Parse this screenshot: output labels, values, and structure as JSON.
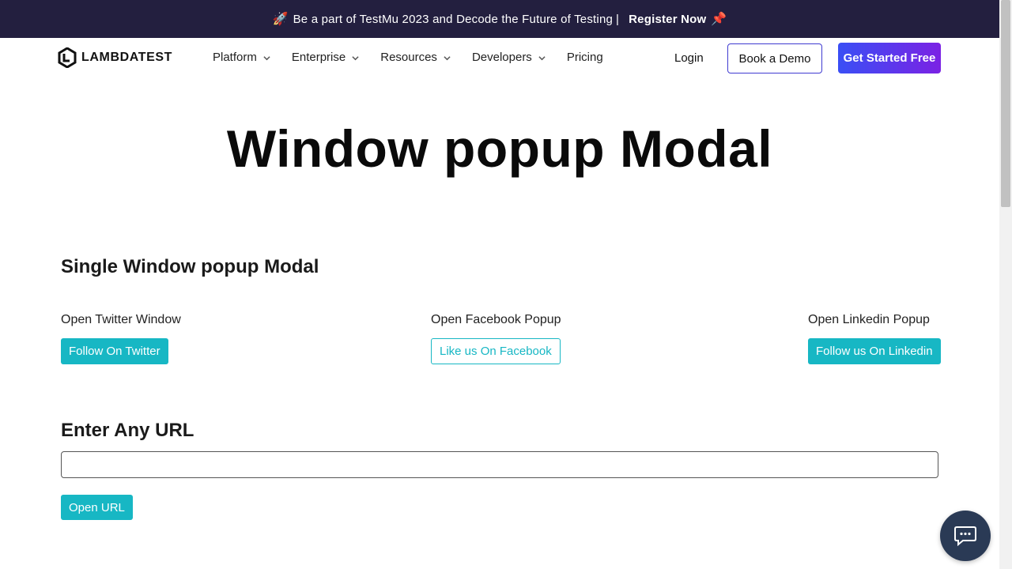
{
  "announcement": {
    "text": "Be a part of TestMu 2023 and Decode the Future of Testing",
    "separator": "|",
    "link": "Register Now",
    "rocket_icon": "rocket-icon",
    "pin_icon": "pushpin-icon"
  },
  "nav": {
    "brand": "LAMBDATEST",
    "items": [
      {
        "label": "Platform",
        "has_dropdown": true
      },
      {
        "label": "Enterprise",
        "has_dropdown": true
      },
      {
        "label": "Resources",
        "has_dropdown": true
      },
      {
        "label": "Developers",
        "has_dropdown": true
      },
      {
        "label": "Pricing",
        "has_dropdown": false
      }
    ],
    "login": "Login",
    "book_demo": "Book a Demo",
    "get_started": "Get Started Free"
  },
  "page": {
    "title": "Window popup Modal",
    "section_title": "Single Window popup Modal",
    "popups": [
      {
        "label": "Open Twitter Window",
        "button": "Follow On Twitter"
      },
      {
        "label": "Open Facebook Popup",
        "button": "Like us On Facebook"
      },
      {
        "label": "Open Linkedin Popup",
        "button": "Follow us On Linkedin"
      }
    ],
    "url_title": "Enter Any URL",
    "url_value": "",
    "url_placeholder": "",
    "open_button": "Open URL"
  },
  "colors": {
    "announcement_bg": "#231f3f",
    "teal": "#17b7c4",
    "cta_gradient_start": "#3a4ff5",
    "cta_gradient_end": "#7b22e4",
    "chat_bg": "#2a3a55"
  }
}
